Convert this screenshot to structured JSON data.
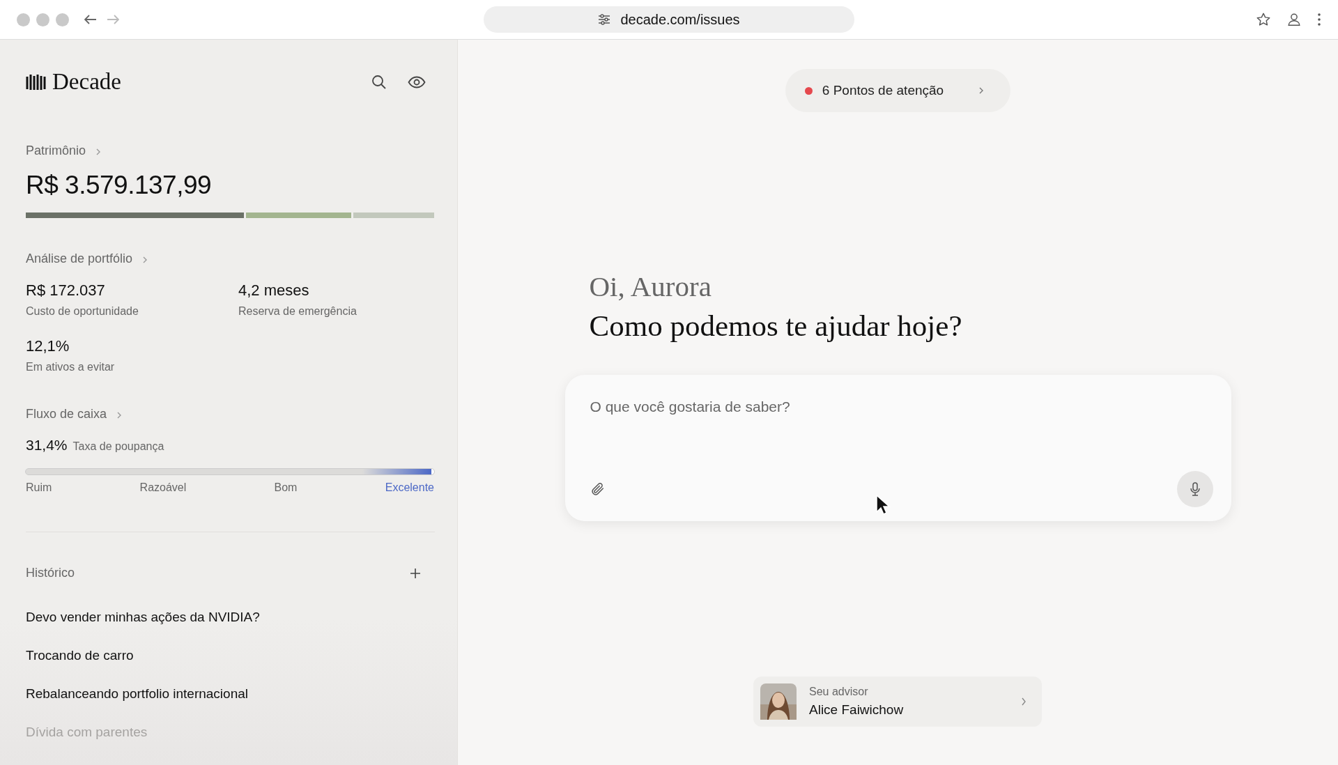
{
  "browser": {
    "url": "decade.com/issues"
  },
  "sidebar": {
    "brand": "Decade",
    "wealth": {
      "title": "Patrimônio",
      "value": "R$ 3.579.137,99",
      "segments": [
        {
          "color": "#6b7167"
        },
        {
          "color": "#a3b58f"
        },
        {
          "color": "#c2c8bc"
        }
      ]
    },
    "portfolio": {
      "title": "Análise de portfólio",
      "metrics": [
        {
          "value": "R$ 172.037",
          "label": "Custo de oportunidade"
        },
        {
          "value": "4,2 meses",
          "label": "Reserva de emergência"
        },
        {
          "value": "12,1%",
          "label": "Em ativos a evitar"
        }
      ]
    },
    "cash_flow": {
      "title": "Fluxo de caixa",
      "value": "31,4%",
      "label": "Taxa de poupança",
      "level": 1.0,
      "scale": [
        {
          "label": "Ruim",
          "selected": false
        },
        {
          "label": "Razoável",
          "selected": false
        },
        {
          "label": "Bom",
          "selected": false
        },
        {
          "label": "Excelente",
          "selected": true
        }
      ]
    },
    "history": {
      "title": "Histórico",
      "items": [
        {
          "label": "Devo vender minhas ações da NVIDIA?",
          "dimmed": false
        },
        {
          "label": "Trocando de carro",
          "dimmed": false
        },
        {
          "label": "Rebalanceando portfolio internacional",
          "dimmed": false
        },
        {
          "label": "Dívida com parentes",
          "dimmed": true
        }
      ]
    }
  },
  "main": {
    "alert": {
      "label": "6 Pontos de atenção",
      "color": "#e5484d"
    },
    "greeting": "Oi, Aurora",
    "headline": "Como podemos te ajudar hoje?",
    "prompt": {
      "placeholder": "O que você gostaria de saber?"
    },
    "advisor": {
      "caption": "Seu advisor",
      "name": "Alice Faiwichow"
    }
  }
}
